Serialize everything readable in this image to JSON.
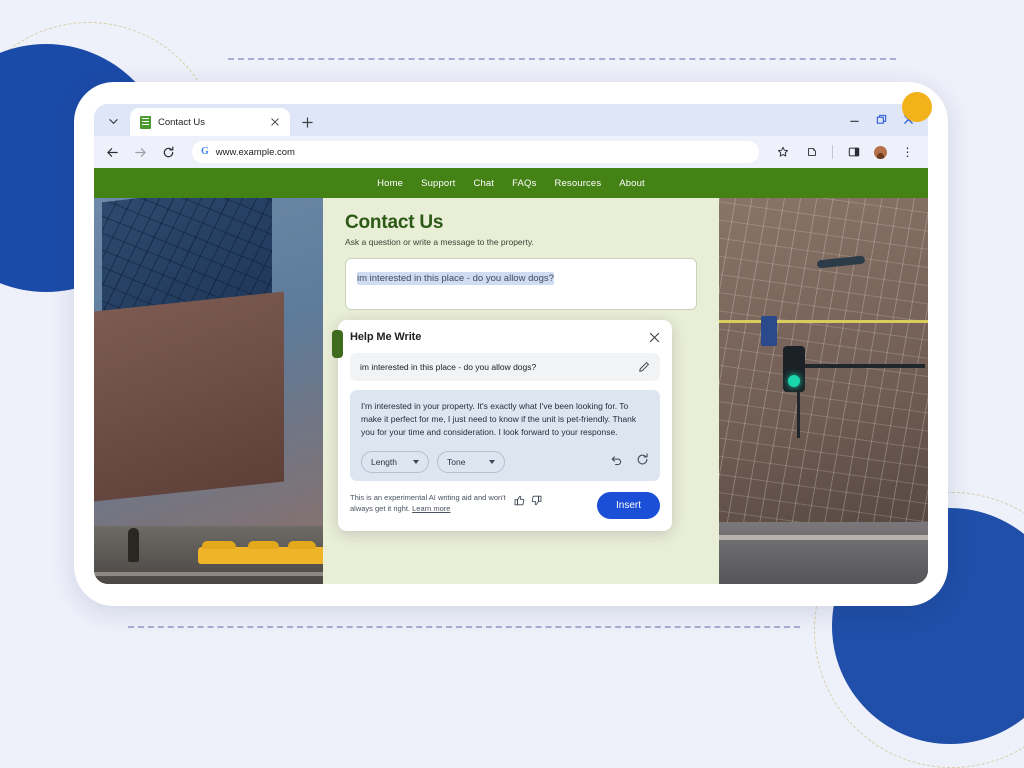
{
  "browser": {
    "tab": {
      "title": "Contact Us",
      "favicon": "document-icon"
    },
    "new_tab_label": "+",
    "close_label": "×",
    "window_controls": {
      "minimize": "—",
      "maximize": "❐",
      "close": "✕"
    },
    "toolbar": {
      "back": "←",
      "forward": "→",
      "reload": "⟳",
      "search_engine_badge": "G",
      "url": "www.example.com",
      "bookmark": "star-icon",
      "extensions": "extensions-icon",
      "side_panel": "side-panel-icon",
      "profile": "avatar-icon",
      "menu": "⋮"
    }
  },
  "site": {
    "nav": [
      {
        "label": "Home"
      },
      {
        "label": "Support"
      },
      {
        "label": "Chat"
      },
      {
        "label": "FAQs"
      },
      {
        "label": "Resources"
      },
      {
        "label": "About"
      }
    ],
    "heading": "Contact Us",
    "subheading": "Ask a question or write a message to the property.",
    "message_value": "im interested in this place - do you allow dogs?",
    "nav_color": "#448216",
    "heading_color": "#2c5a16",
    "page_bg": "#e9eed6"
  },
  "help_me_write": {
    "title": "Help Me Write",
    "close_label": "✕",
    "prompt": "im interested in this place - do you allow dogs?",
    "edit_icon": "pencil-icon",
    "result": "I'm interested in your property. It's exactly what I've been looking for. To make it perfect for me, I just need to know if the unit is pet-friendly. Thank you for your time and consideration. I look forward to your response.",
    "controls": [
      {
        "label": "Length"
      },
      {
        "label": "Tone"
      }
    ],
    "undo_icon": "undo-icon",
    "refresh_icon": "refresh-icon",
    "disclaimer_line1": "This is an experimental AI writing aid and",
    "disclaimer_line2": "won't always get it right.",
    "learn_more": "Learn more",
    "thumbs_up_icon": "thumbs-up-icon",
    "thumbs_down_icon": "thumbs-down-icon",
    "insert_label": "Insert",
    "insert_color": "#1b4fd8"
  },
  "decorations": {
    "blue": "#1b4ba8",
    "amber": "#f2b21a",
    "dashed": "#9aa4c8"
  }
}
